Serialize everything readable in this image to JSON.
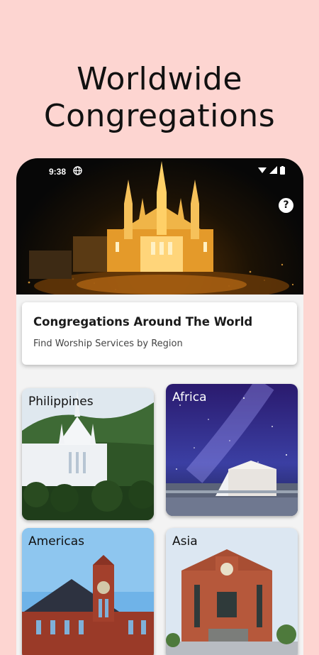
{
  "headline": {
    "line1": "Worldwide",
    "line2": "Congregations"
  },
  "statusbar": {
    "time": "9:38"
  },
  "info_card": {
    "title": "Congregations Around The World",
    "subtitle": "Find Worship Services by Region"
  },
  "help_button": {
    "label": "?"
  },
  "regions": [
    {
      "label": "Philippines"
    },
    {
      "label": "Africa"
    },
    {
      "label": "Americas"
    },
    {
      "label": "Asia"
    }
  ],
  "colors": {
    "background": "#fdd5d1",
    "card": "#ffffff",
    "hero_glow": "#f5a623"
  }
}
